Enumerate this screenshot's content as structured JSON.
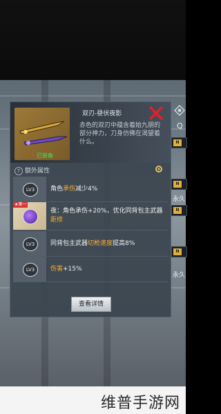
{
  "weapon": {
    "name": "双刃-昼伏夜影",
    "status": "已装备",
    "description": "赤色的双刃中蕴含着始九朋的部分神力，刀身仿佛在渴望着什么。"
  },
  "attributes": {
    "title": "额外属性",
    "rows": [
      {
        "level": "LV3",
        "parts": [
          "角色",
          "承伤",
          "减少4%"
        ]
      },
      {
        "tag": "★第一",
        "parts": [
          "夜：角色承伤+20%，优化同背包主武器",
          "距修",
          ""
        ]
      },
      {
        "level": "LV3",
        "parts": [
          "同背包主武器",
          "切枪速度",
          "提高8%"
        ]
      },
      {
        "level": "LV3",
        "parts": [
          "",
          "伤害",
          "+15%"
        ]
      }
    ]
  },
  "buttons": {
    "detail": "查看详情"
  },
  "side": {
    "search": "Q",
    "labels": [
      "永久",
      "永久"
    ]
  },
  "watermark": "维普手游网",
  "colors": {
    "highlight": "#ffad33",
    "equipped": "#3ee65a",
    "close": "#e0202a"
  }
}
